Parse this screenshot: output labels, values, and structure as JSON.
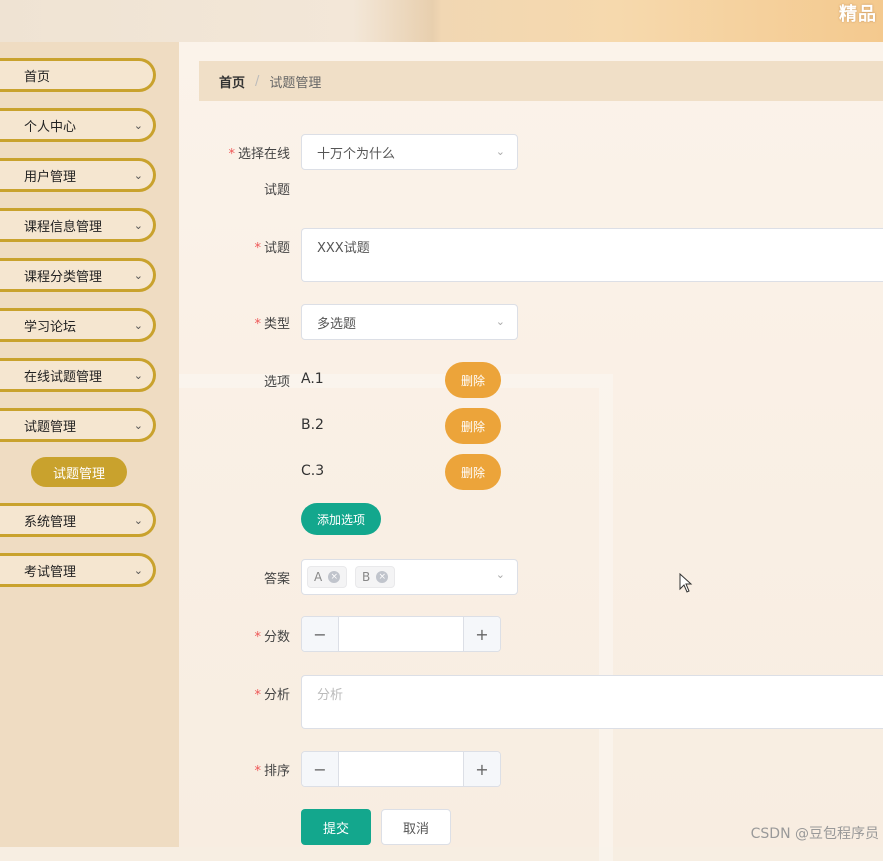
{
  "header": {
    "site_title": "精品"
  },
  "sidebar": {
    "items": [
      {
        "label": "首页",
        "has_chevron": false
      },
      {
        "label": "个人中心",
        "has_chevron": true
      },
      {
        "label": "用户管理",
        "has_chevron": true
      },
      {
        "label": "课程信息管理",
        "has_chevron": true
      },
      {
        "label": "课程分类管理",
        "has_chevron": true
      },
      {
        "label": "学习论坛",
        "has_chevron": true
      },
      {
        "label": "在线试题管理",
        "has_chevron": true
      },
      {
        "label": "试题管理",
        "has_chevron": true
      },
      {
        "label": "系统管理",
        "has_chevron": true
      },
      {
        "label": "考试管理",
        "has_chevron": true
      }
    ],
    "submenu": {
      "active_label": "试题管理"
    },
    "chevron_icon": "chevron-down-icon"
  },
  "breadcrumb": {
    "home": "首页",
    "separator": "/",
    "current": "试题管理"
  },
  "form": {
    "exam": {
      "label_line1": "选择在线",
      "label_line2": "试题",
      "value": "十万个为什么"
    },
    "question": {
      "label": "试题",
      "value": "XXX试题"
    },
    "type": {
      "label": "类型",
      "value": "多选题"
    },
    "options": {
      "label": "选项",
      "items": [
        {
          "text": "A.1",
          "delete_label": "删除"
        },
        {
          "text": "B.2",
          "delete_label": "删除"
        },
        {
          "text": "C.3",
          "delete_label": "删除"
        }
      ],
      "add_label": "添加选项"
    },
    "answer": {
      "label": "答案",
      "tags": [
        "A",
        "B"
      ]
    },
    "score": {
      "label": "分数",
      "value": ""
    },
    "analysis": {
      "label": "分析",
      "placeholder": "分析"
    },
    "sort": {
      "label": "排序",
      "value": ""
    },
    "required_mark": "*",
    "stepper_minus": "−",
    "stepper_plus": "+",
    "submit_label": "提交",
    "cancel_label": "取消"
  },
  "watermark": "CSDN @豆包程序员",
  "colors": {
    "accent_gold": "#c9a22d",
    "primary_green": "#13a78d",
    "delete_orange": "#eca43a"
  }
}
